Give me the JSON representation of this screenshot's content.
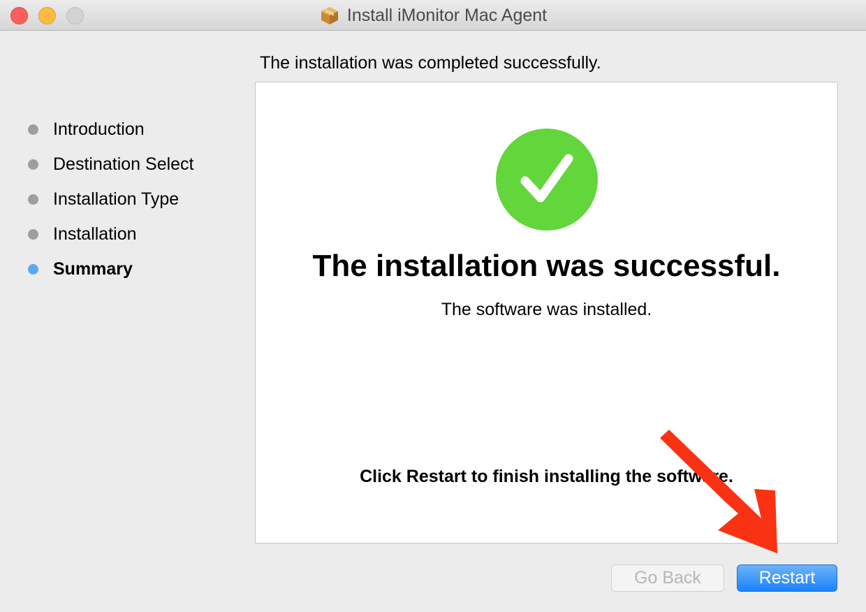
{
  "window": {
    "title": "Install iMonitor Mac Agent",
    "title_icon": "package-icon"
  },
  "heading": "The installation was completed successfully.",
  "sidebar": {
    "items": [
      {
        "label": "Introduction",
        "active": false
      },
      {
        "label": "Destination Select",
        "active": false
      },
      {
        "label": "Installation Type",
        "active": false
      },
      {
        "label": "Installation",
        "active": false
      },
      {
        "label": "Summary",
        "active": true
      }
    ]
  },
  "panel": {
    "status_icon": "checkmark-icon",
    "title": "The installation was successful.",
    "subtitle": "The software was installed.",
    "instruction": "Click Restart to finish installing the software."
  },
  "buttons": {
    "go_back": {
      "label": "Go Back",
      "enabled": false
    },
    "restart": {
      "label": "Restart",
      "enabled": true
    }
  },
  "colors": {
    "success_green": "#62d63b",
    "active_step_dot": "#5aa9ef",
    "inactive_step_dot": "#9e9e9e",
    "primary_button": "#1a82fb",
    "annotation_arrow": "#fa3214"
  },
  "annotation": {
    "icon": "red-arrow-icon",
    "points_to": "restart-button"
  }
}
